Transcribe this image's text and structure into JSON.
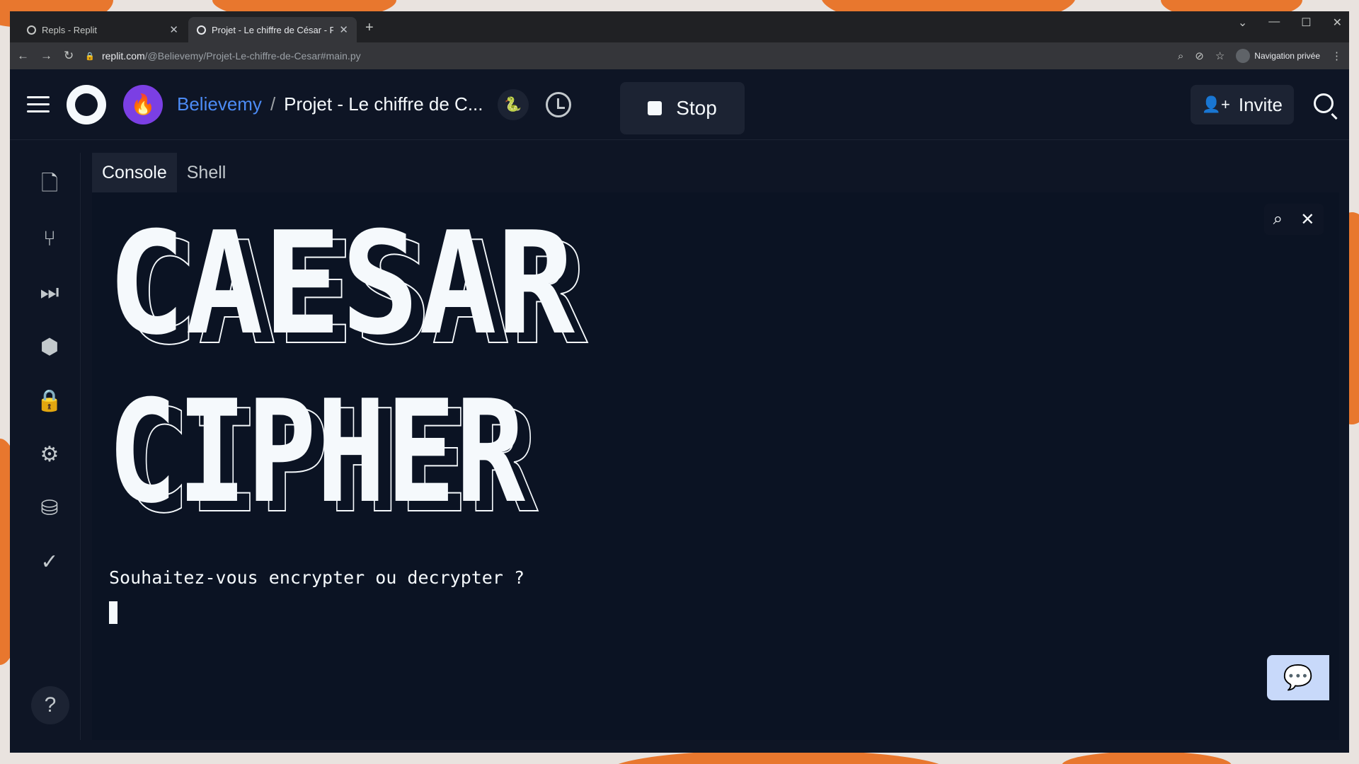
{
  "browser": {
    "tabs": [
      {
        "title": "Repls - Replit",
        "active": false
      },
      {
        "title": "Projet - Le chiffre de César - Repl",
        "active": true
      }
    ],
    "url_domain": "replit.com",
    "url_path": "/@Believemy/Projet-Le-chiffre-de-Cesar#main.py",
    "incognito_label": "Navigation privée"
  },
  "header": {
    "user": "Believemy",
    "separator": "/",
    "project": "Projet - Le chiffre de C...",
    "stop_label": "Stop",
    "invite_label": "Invite"
  },
  "panes": {
    "tabs": [
      {
        "label": "Console",
        "active": true
      },
      {
        "label": "Shell",
        "active": false
      }
    ]
  },
  "console": {
    "ascii_lines": [
      "CAESAR",
      "CIPHER"
    ],
    "prompt": "Souhaitez-vous encrypter ou decrypter ?"
  },
  "sidebar": {
    "icons": [
      "file-icon",
      "git-branch-icon",
      "debugger-icon",
      "packages-icon",
      "lock-icon",
      "gear-icon",
      "database-icon",
      "check-icon"
    ]
  },
  "colors": {
    "background": "#0e1525",
    "accent_blue": "#4c8bf5",
    "avatar_purple": "#7b3fe4"
  }
}
